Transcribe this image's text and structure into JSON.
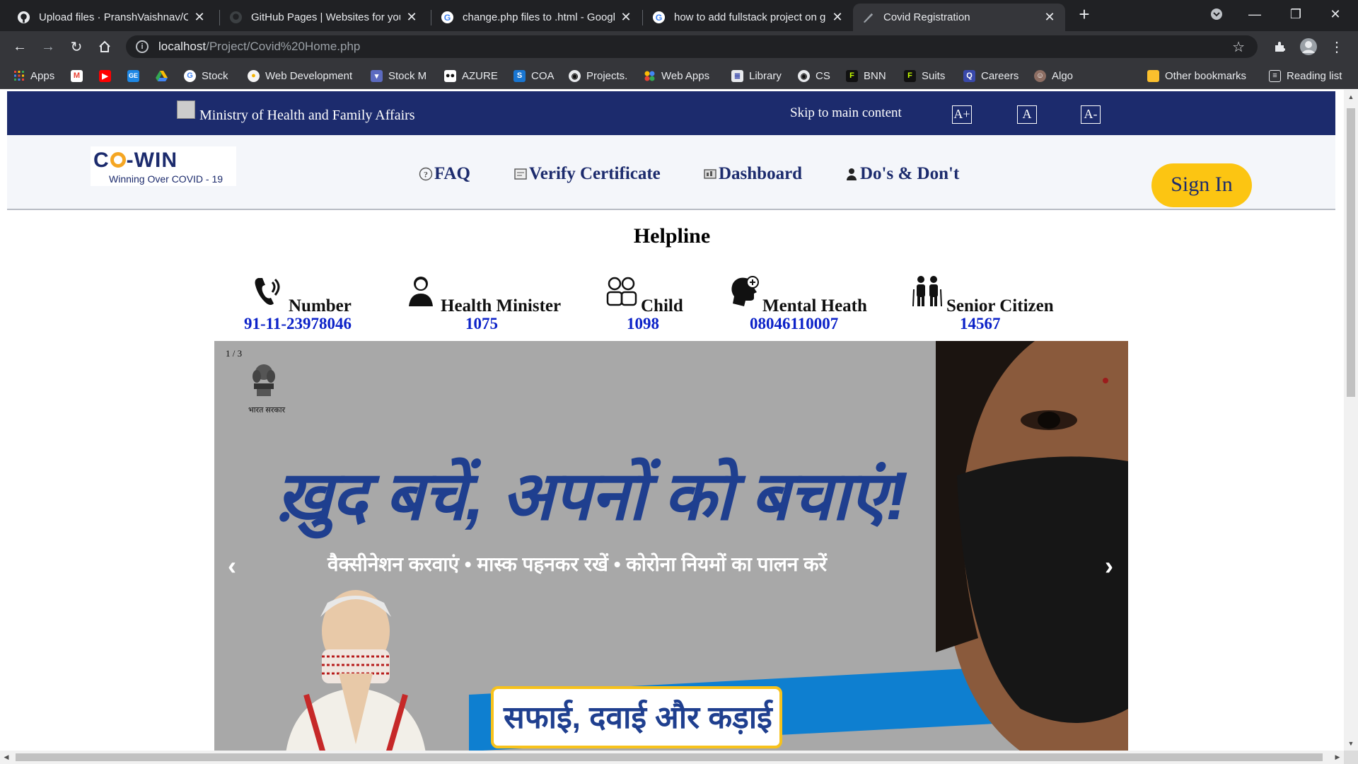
{
  "browser": {
    "tabs": [
      {
        "title": "Upload files · PranshVaishnav/Co",
        "favicon": "github-icon"
      },
      {
        "title": "GitHub Pages | Websites for you",
        "favicon": "github-icon"
      },
      {
        "title": "change.php files to .html - Googl",
        "favicon": "google-icon"
      },
      {
        "title": "how to add fullstack project on g",
        "favicon": "google-icon"
      },
      {
        "title": "Covid Registration",
        "favicon": "feather-icon"
      }
    ],
    "url_host": "localhost",
    "url_path": "/Project/Covid%20Home.php",
    "bookmarks": [
      {
        "label": "Apps",
        "icon": "apps-grid-icon",
        "color": "#ea4335"
      },
      {
        "label": "",
        "icon": "gmail-icon",
        "color": "#ea4335"
      },
      {
        "label": "",
        "icon": "youtube-icon",
        "color": "#ff0000"
      },
      {
        "label": "",
        "icon": "google-classroom-icon",
        "color": "#1e88e5"
      },
      {
        "label": "",
        "icon": "google-drive-icon",
        "color": "#fbbc04"
      },
      {
        "label": "Stock",
        "icon": "google-icon",
        "color": "#4285f4"
      },
      {
        "label": "Web Development",
        "icon": "circle-icon",
        "color": "#f4b400"
      },
      {
        "label": "Stock M",
        "icon": "shield-icon",
        "color": "#3f51b5"
      },
      {
        "label": "AZURE",
        "icon": "medium-icon",
        "color": "#111111"
      },
      {
        "label": "COA",
        "icon": "s-icon",
        "color": "#1976d2"
      },
      {
        "label": "Projects.",
        "icon": "github-icon",
        "color": "#111111"
      },
      {
        "label": "Web Apps",
        "icon": "dots-icon",
        "color": "#34a853"
      },
      {
        "label": "Library",
        "icon": "book-icon",
        "color": "#5c6bc0"
      },
      {
        "label": "CS",
        "icon": "github-icon",
        "color": "#111111"
      },
      {
        "label": "BNN",
        "icon": "f-icon",
        "color": "#2e7d32"
      },
      {
        "label": "Suits",
        "icon": "f-icon",
        "color": "#2e7d32"
      },
      {
        "label": "Careers",
        "icon": "q-icon",
        "color": "#3949ab"
      },
      {
        "label": "Algo",
        "icon": "avatar-icon",
        "color": "#8d6e63"
      }
    ],
    "other_bookmarks": "Other bookmarks",
    "reading_list": "Reading list"
  },
  "site": {
    "ministry": "Ministry of Health and Family Affairs",
    "skip": "Skip to main content",
    "font_buttons": [
      "A+",
      "A",
      "A-"
    ],
    "logo_brand_left": "C",
    "logo_brand_right": "-WIN",
    "logo_tagline": "Winning Over COVID - 19",
    "nav": [
      {
        "label": "FAQ",
        "icon": "question-icon"
      },
      {
        "label": "Verify Certificate",
        "icon": "certificate-icon"
      },
      {
        "label": "Dashboard",
        "icon": "dashboard-icon"
      },
      {
        "label": "Do's & Don't",
        "icon": "person-icon"
      }
    ],
    "signin": "Sign In",
    "helpline_title": "Helpline",
    "helplines": [
      {
        "name": "Number",
        "number": "91-11-23978046",
        "icon": "phone-icon"
      },
      {
        "name": "Health Minister",
        "number": "1075",
        "icon": "minister-icon"
      },
      {
        "name": "Child",
        "number": "1098",
        "icon": "children-icon"
      },
      {
        "name": "Mental Heath",
        "number": "08046110007",
        "icon": "mental-health-icon"
      },
      {
        "name": "Senior Citizen",
        "number": "14567",
        "icon": "senior-citizen-icon"
      }
    ],
    "carousel": {
      "counter": "1 / 3",
      "gov_text": "भारत सरकार",
      "headline": "ख़ुद बचें, अपनों को बचाएं!",
      "subline": "वैक्सीनेशन करवाएं  •  मास्क पहनकर रखें  •  कोरोना नियमों का पालन करें",
      "box_text": "सफाई, दवाई और कड़ाई",
      "prev": "‹",
      "next": "›"
    }
  },
  "colors": {
    "navy": "#1c2b6d",
    "accent": "#fcc512",
    "helpline_number": "#0c22c8"
  }
}
